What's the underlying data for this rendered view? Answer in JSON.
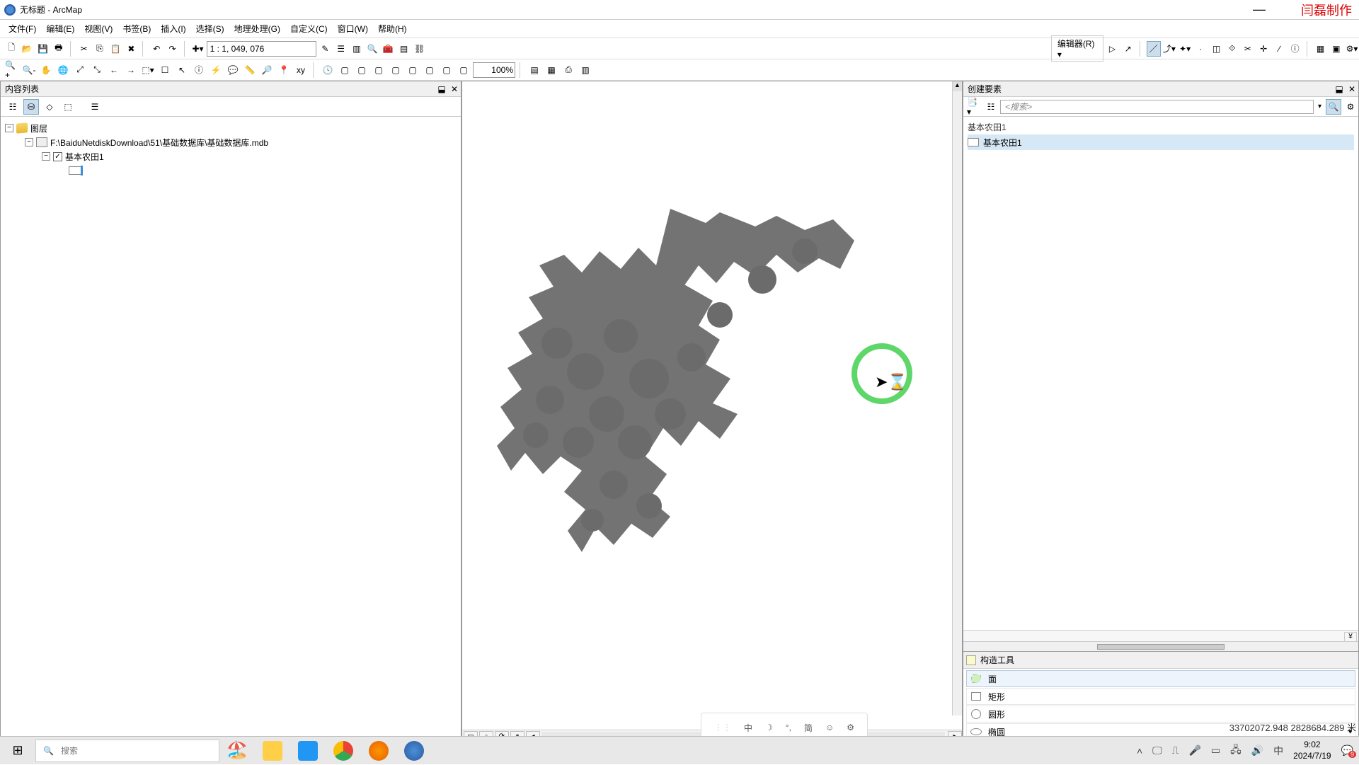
{
  "title": "无标题 - ArcMap",
  "watermark": "闫磊制作",
  "menu": {
    "file": "文件(F)",
    "edit": "编辑(E)",
    "view": "视图(V)",
    "bookmarks": "书签(B)",
    "insert": "插入(I)",
    "select": "选择(S)",
    "geoprocessing": "地理处理(G)",
    "customize": "自定义(C)",
    "window": "窗口(W)",
    "help": "帮助(H)"
  },
  "scale": "1 : 1, 049, 076",
  "zoom": "100%",
  "editor_menu": "编辑器(R)",
  "toc": {
    "title": "内容列表",
    "root": "图层",
    "gdb_path": "F:\\BaiduNetdiskDownload\\51\\基础数据库\\基础数据库.mdb",
    "layer": "基本农田1"
  },
  "create_features": {
    "title": "创建要素",
    "search_placeholder": "<搜索>",
    "group": "基本农田1",
    "template": "基本农田1"
  },
  "construct": {
    "title": "构造工具",
    "poly": "面",
    "rect": "矩形",
    "circle": "圆形",
    "ellipse": "椭圆"
  },
  "coordinates": "33702072.948  2828684.289 米",
  "ime": {
    "zhong": "中",
    "moon": "☽",
    "punct": "°,",
    "simp": "简",
    "emoji": "☺",
    "gear": "⚙"
  },
  "windows": {
    "start": "⊞",
    "search_placeholder": "搜索"
  },
  "systray": {
    "time": "9:02",
    "date": "2024/7/19",
    "ime": "中",
    "badge": "9"
  }
}
